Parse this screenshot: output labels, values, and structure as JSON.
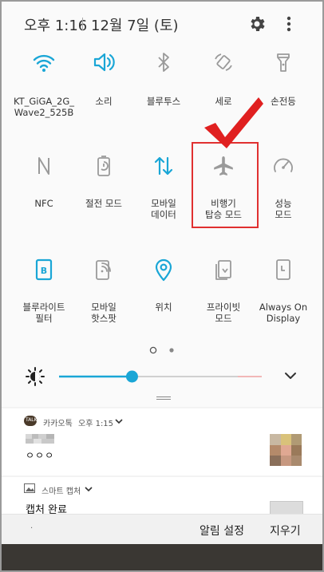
{
  "status_bar": {
    "time": "오후 1:16",
    "date": "12월 7일 (토)",
    "settings_icon": "gear-icon",
    "more_icon": "more-vertical-icon"
  },
  "quick_settings": {
    "row1": [
      {
        "label": "KT_GiGA_2G_\nWave2_525B",
        "icon": "wifi-icon",
        "active": true
      },
      {
        "label": "소리",
        "icon": "sound-icon",
        "active": true
      },
      {
        "label": "블루투스",
        "icon": "bluetooth-icon",
        "active": false
      },
      {
        "label": "세로",
        "icon": "rotate-icon",
        "active": false
      },
      {
        "label": "손전등",
        "icon": "flashlight-icon",
        "active": false
      }
    ],
    "row2": [
      {
        "label": "NFC",
        "icon": "nfc-icon",
        "active": false
      },
      {
        "label": "절전 모드",
        "icon": "power-saving-icon",
        "active": false
      },
      {
        "label": "모바일\n데이터",
        "icon": "mobile-data-icon",
        "active": true
      },
      {
        "label": "비행기\n탑승 모드",
        "icon": "airplane-icon",
        "active": false
      },
      {
        "label": "성능\n모드",
        "icon": "performance-icon",
        "active": false
      }
    ],
    "row3": [
      {
        "label": "블루라이트\n필터",
        "icon": "blue-light-icon",
        "active": true
      },
      {
        "label": "모바일\n핫스팟",
        "icon": "hotspot-icon",
        "active": false
      },
      {
        "label": "위치",
        "icon": "location-icon",
        "active": true
      },
      {
        "label": "프라이빗\n모드",
        "icon": "private-mode-icon",
        "active": false
      },
      {
        "label": "Always On\nDisplay",
        "icon": "always-on-display-icon",
        "active": false
      }
    ]
  },
  "brightness": {
    "level": 0.36
  },
  "notifications": [
    {
      "app": "카카오톡",
      "time": "오후 1:15",
      "body": "ㅇㅇㅇ"
    },
    {
      "app": "스마트 캡처",
      "title": "캡처 완료"
    }
  ],
  "actions": {
    "settings": "알림 설정",
    "clear": "지우기"
  },
  "colors": {
    "accent": "#1aa6d6",
    "inactive": "#9a9a9a",
    "highlight": "#e03030"
  }
}
